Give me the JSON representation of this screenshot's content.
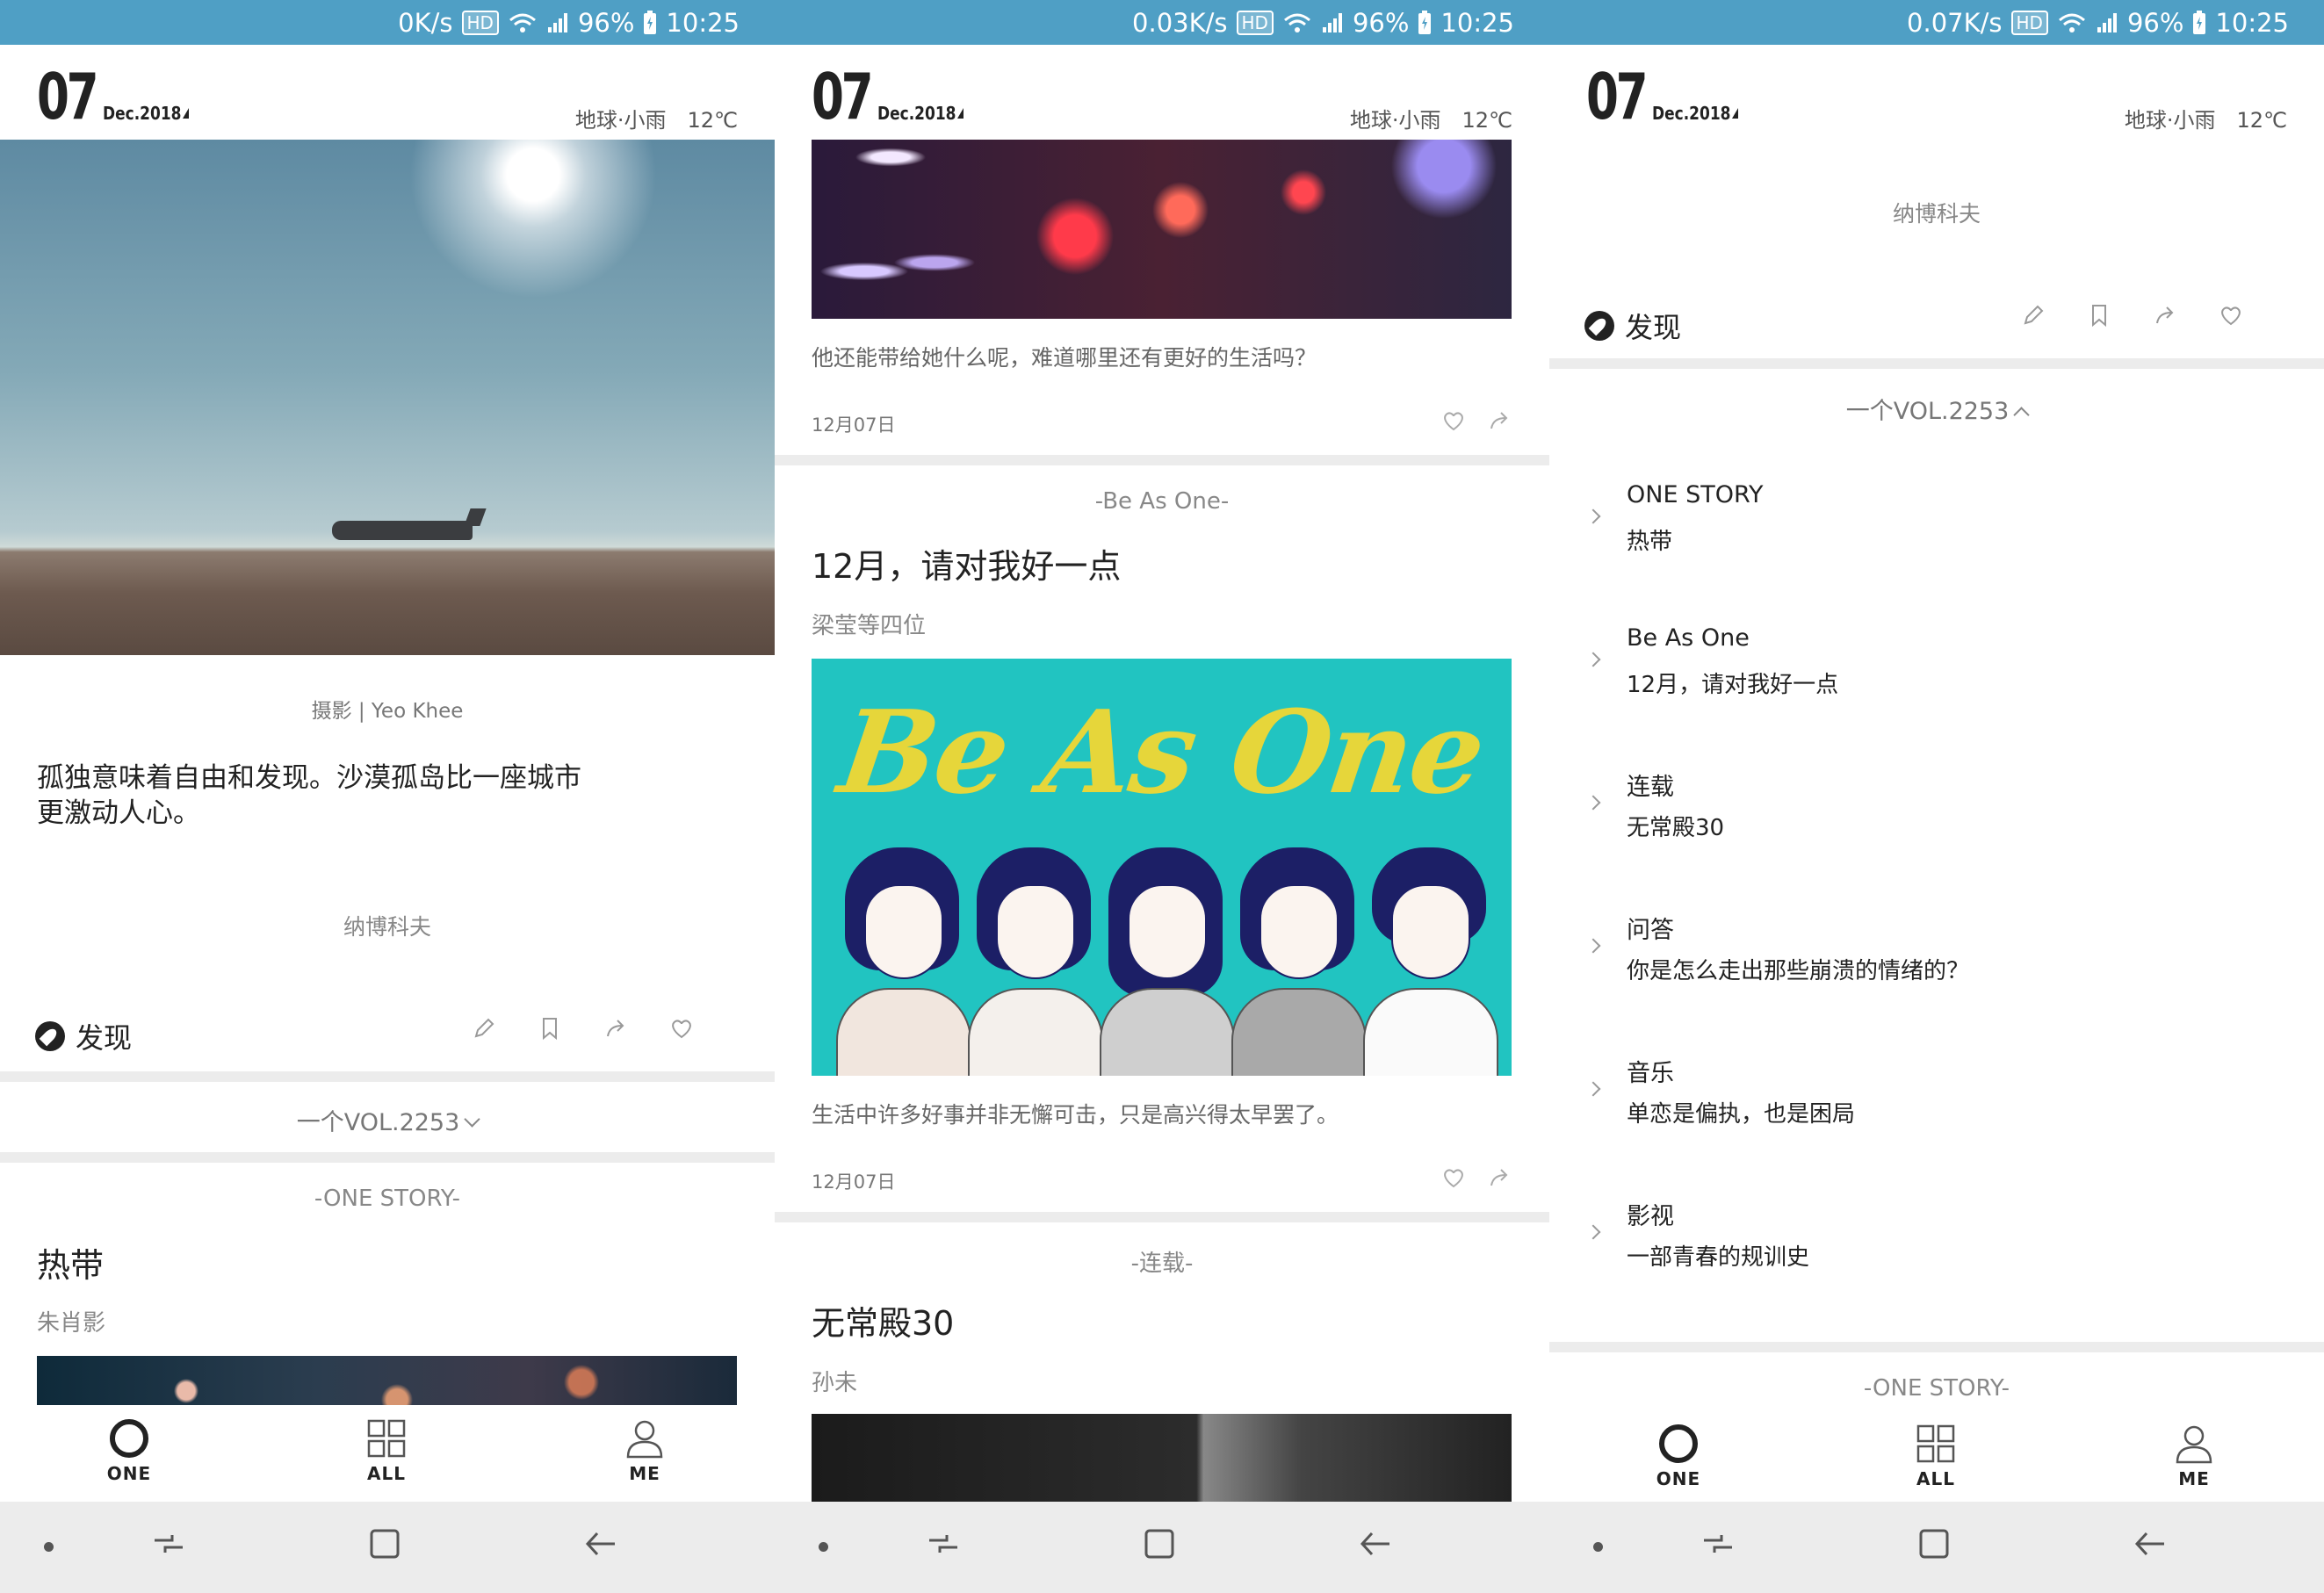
{
  "status": {
    "screens": [
      {
        "speed": "0K/s",
        "hd": "HD",
        "battery": "96%",
        "time": "10:25"
      },
      {
        "speed": "0.03K/s",
        "hd": "HD",
        "battery": "96%",
        "time": "10:25"
      },
      {
        "speed": "0.07K/s",
        "hd": "HD",
        "battery": "96%",
        "time": "10:25"
      }
    ]
  },
  "header": {
    "day": "07",
    "month": "Dec.2018",
    "location": "地球·小雨",
    "temperature": "12℃"
  },
  "screen1": {
    "photo_caption": "摄影 | Yeo Khee",
    "quote": "孤独意味着自由和发现。沙漠孤岛比一座城市更激动人心。",
    "quote_author": "纳博科夫",
    "discover_label": "发现",
    "vol_label": "一个VOL.2253",
    "story_category": "-ONE STORY-",
    "story_title": "热带",
    "story_author": "朱肖影"
  },
  "screen2": {
    "card1_text": "他还能带给她什么呢，难道哪里还有更好的生活吗？",
    "card1_date": "12月07日",
    "card2_category": "-Be As One-",
    "card2_title": "12月，请对我好一点",
    "card2_author": "梁莹等四位",
    "card2_illustration_text": "Be As One",
    "card2_text": "生活中许多好事并非无懈可击，只是高兴得太早罢了。",
    "card2_date": "12月07日",
    "card3_category": "-连载-",
    "card3_title": "无常殿30",
    "card3_author": "孙未"
  },
  "screen3": {
    "quote_author": "纳博科夫",
    "discover_label": "发现",
    "vol_label": "一个VOL.2253",
    "items": [
      {
        "category": "ONE STORY",
        "title": "热带"
      },
      {
        "category": "Be As One",
        "title": "12月，请对我好一点"
      },
      {
        "category": "连载",
        "title": "无常殿30"
      },
      {
        "category": "问答",
        "title": "你是怎么走出那些崩溃的情绪的？"
      },
      {
        "category": "音乐",
        "title": "单恋是偏执，也是困局"
      },
      {
        "category": "影视",
        "title": "一部青春的规训史"
      }
    ],
    "bottom_category": "-ONE STORY-"
  },
  "tabs": [
    {
      "label": "ONE",
      "icon": "one-circle-icon"
    },
    {
      "label": "ALL",
      "icon": "grid-icon"
    },
    {
      "label": "ME",
      "icon": "person-icon"
    }
  ],
  "colors": {
    "status_bar": "#4f9fc5",
    "illustration_bg": "#21c4c1",
    "illustration_title": "#e6d63a"
  }
}
